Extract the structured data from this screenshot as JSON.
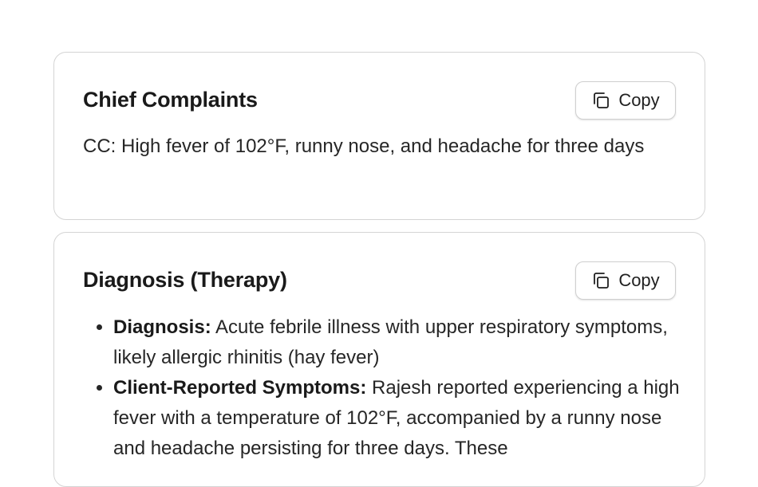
{
  "sections": [
    {
      "title": "Chief Complaints",
      "copy_label": "Copy",
      "text": "CC: High fever of 102°F, runny nose, and headache for three days"
    },
    {
      "title": "Diagnosis (Therapy)",
      "copy_label": "Copy",
      "items": [
        {
          "label": "Diagnosis:",
          "text": " Acute febrile illness with upper respiratory symptoms, likely allergic rhinitis (hay fever)"
        },
        {
          "label": "Client-Reported Symptoms:",
          "text": " Rajesh reported experiencing a high fever with a temperature of 102°F, accompanied by a runny nose and headache persisting for three days. These"
        }
      ]
    }
  ]
}
